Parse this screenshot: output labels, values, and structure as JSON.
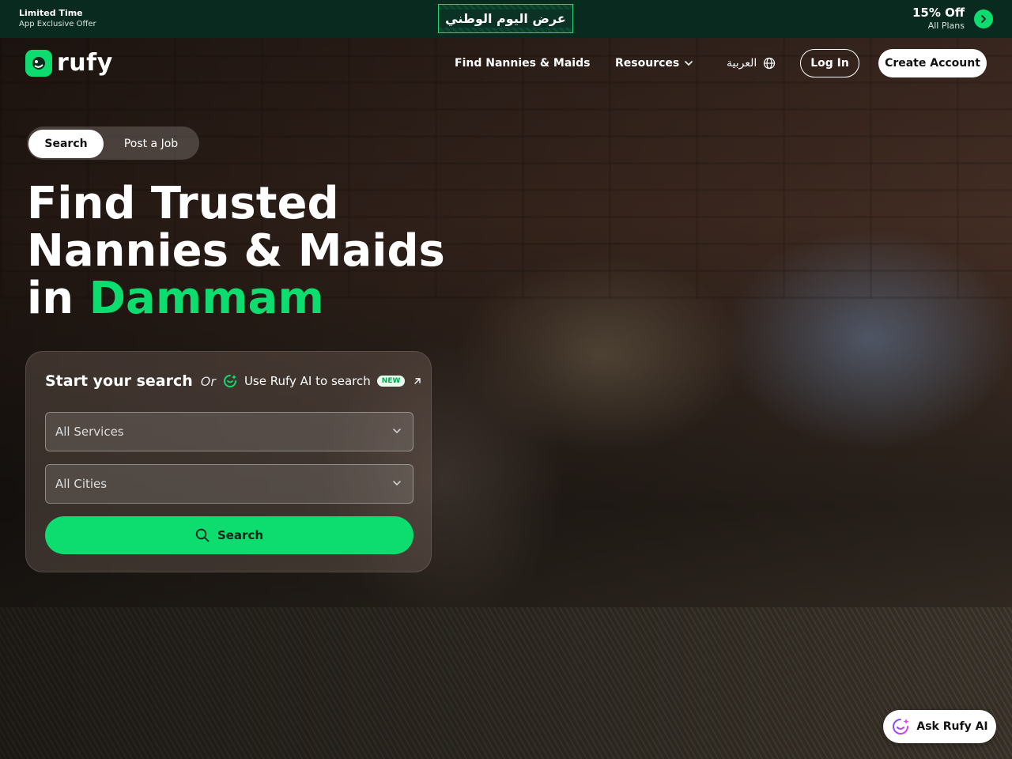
{
  "promo": {
    "line1": " Limited Time",
    "line2": "App Exclusive Offer",
    "badge_text": "عرض اليوم الوطني",
    "discount": "15% Off",
    "discount_sub": "All Plans"
  },
  "nav": {
    "logo_text": "rufy",
    "find": "Find Nannies & Maids",
    "resources": "Resources",
    "language": "العربية",
    "login": "Log In",
    "create_account": "Create Account"
  },
  "tabs": [
    {
      "label": "Search",
      "active": true
    },
    {
      "label": "Post a Job",
      "active": false
    }
  ],
  "headline": {
    "line1": "Find Trusted",
    "line2": "Nannies & Maids",
    "line3_prefix": "in ",
    "city": "Dammam"
  },
  "search_card": {
    "title": "Start your search",
    "or": "Or",
    "ai_link": "Use Rufy AI to search",
    "new_badge": "NEW",
    "services_value": "All Services",
    "cities_value": "All Cities",
    "search_button": "Search"
  },
  "ask_ai": "Ask Rufy AI",
  "colors": {
    "accent": "#0ddc6f",
    "banner_bg": "#082a1f"
  },
  "icons": [
    "apple-icon",
    "chevron-right-icon",
    "chevron-down-icon",
    "globe-icon",
    "ai-sparkle-icon",
    "external-arrow-icon",
    "search-icon",
    "ask-ai-icon"
  ]
}
